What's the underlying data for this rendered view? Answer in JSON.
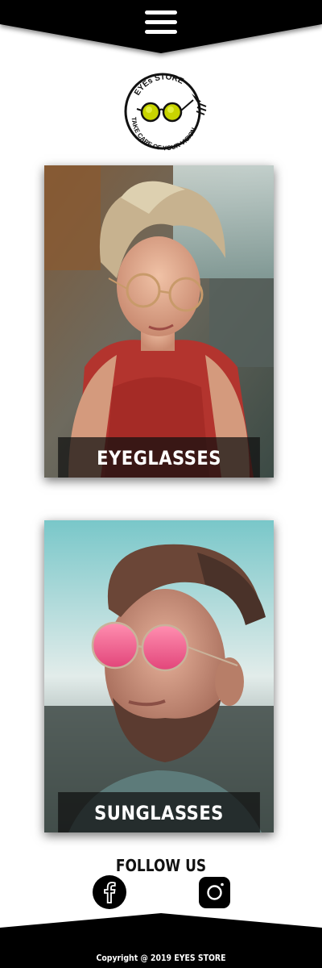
{
  "header": {
    "menu_icon": "hamburger-menu-icon"
  },
  "logo": {
    "top_text": "EYEs STORE",
    "bottom_text": "TAKE CARE OF YOUR VISION",
    "icon": "round-glasses-icon"
  },
  "categories": [
    {
      "label": "EYEGLASSES"
    },
    {
      "label": "SUNGLASSES"
    }
  ],
  "social": {
    "title": "FOLLOW US",
    "items": [
      {
        "icon": "facebook-icon"
      },
      {
        "icon": "instagram-icon"
      }
    ]
  },
  "footer": {
    "copyright": "Copyright @ 2019 EYES STORE"
  },
  "colors": {
    "header_bg": "#000000",
    "page_bg": "#ffffff",
    "caption_bg": "#0f0f0f",
    "text": "#ffffff"
  }
}
